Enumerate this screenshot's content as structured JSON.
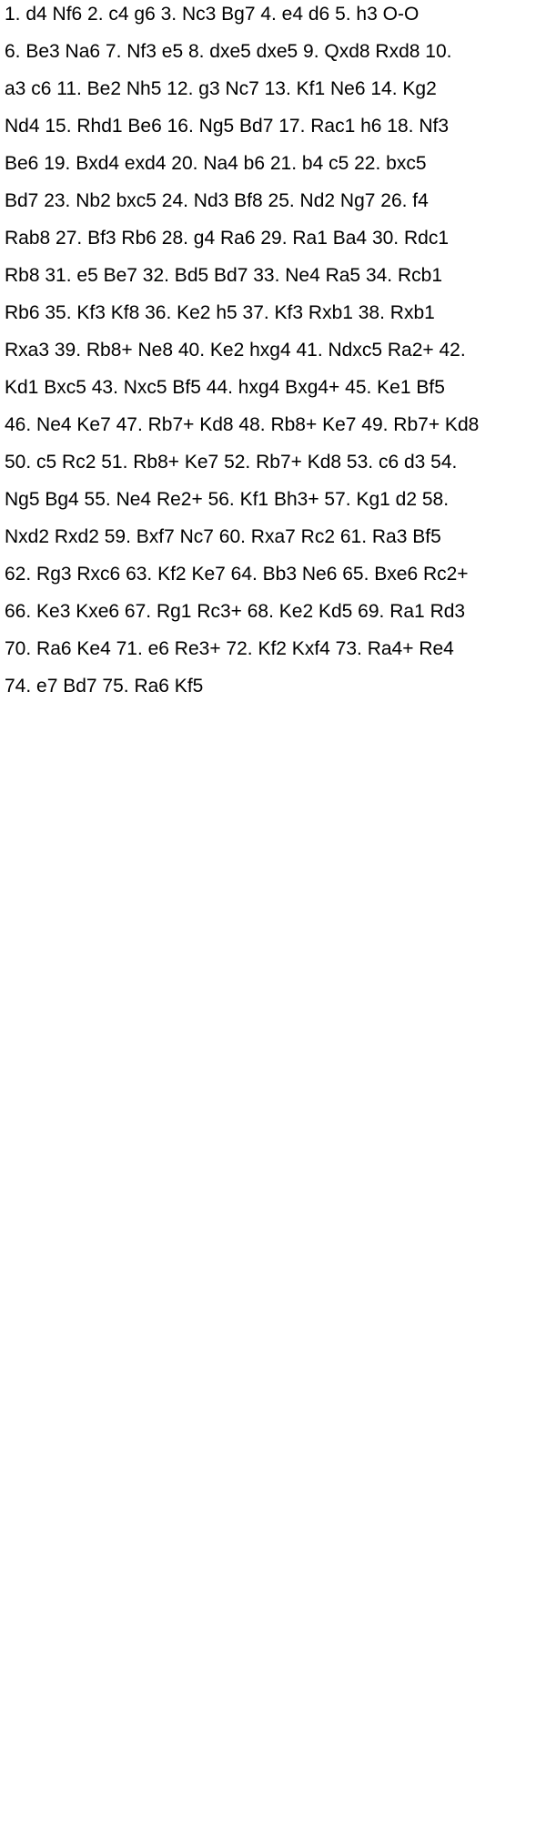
{
  "document": {
    "lines": [
      "1. d4 Nf6 2. c4 g6 3. Nc3 Bg7 4. e4 d6 5. h3 O-O",
      "6. Be3 Na6 7. Nf3 e5 8. dxe5 dxe5 9. Qxd8 Rxd8 10.",
      "a3 c6 11. Be2 Nh5 12. g3 Nc7 13. Kf1 Ne6 14. Kg2",
      "Nd4 15. Rhd1 Be6 16. Ng5 Bd7 17. Rac1 h6 18. Nf3",
      "Be6 19. Bxd4 exd4 20. Na4 b6 21. b4 c5 22. bxc5",
      "Bd7 23. Nb2 bxc5 24. Nd3 Bf8 25. Nd2 Ng7 26. f4",
      "Rab8 27. Bf3 Rb6 28. g4 Ra6 29. Ra1 Ba4 30. Rdc1",
      "Rb8 31. e5 Be7 32. Bd5 Bd7 33. Ne4 Ra5 34. Rcb1",
      "Rb6 35. Kf3 Kf8 36. Ke2 h5 37. Kf3 Rxb1 38. Rxb1",
      "Rxa3 39. Rb8+ Ne8 40. Ke2 hxg4 41. Ndxc5 Ra2+ 42.",
      "Kd1 Bxc5 43. Nxc5 Bf5 44. hxg4 Bxg4+ 45. Ke1 Bf5",
      "46. Ne4 Ke7 47. Rb7+ Kd8 48. Rb8+ Ke7 49. Rb7+ Kd8",
      "50. c5 Rc2 51. Rb8+ Ke7 52. Rb7+ Kd8 53. c6 d3 54.",
      "Ng5 Bg4 55. Ne4 Re2+ 56. Kf1 Bh3+ 57. Kg1 d2 58.",
      "Nxd2 Rxd2 59. Bxf7 Nc7 60. Rxa7 Rc2 61. Ra3 Bf5",
      "62. Rg3 Rxc6 63. Kf2 Ke7 64. Bb3 Ne6 65. Bxe6 Rc2+",
      "66. Ke3 Kxe6 67. Rg1 Rc3+ 68. Ke2 Kd5 69. Ra1 Rd3",
      "70. Ra6 Ke4 71. e6 Re3+ 72. Kf2 Kxf4 73. Ra4+ Re4",
      "74. e7 Bd7 75. Ra6 Kf5"
    ]
  }
}
